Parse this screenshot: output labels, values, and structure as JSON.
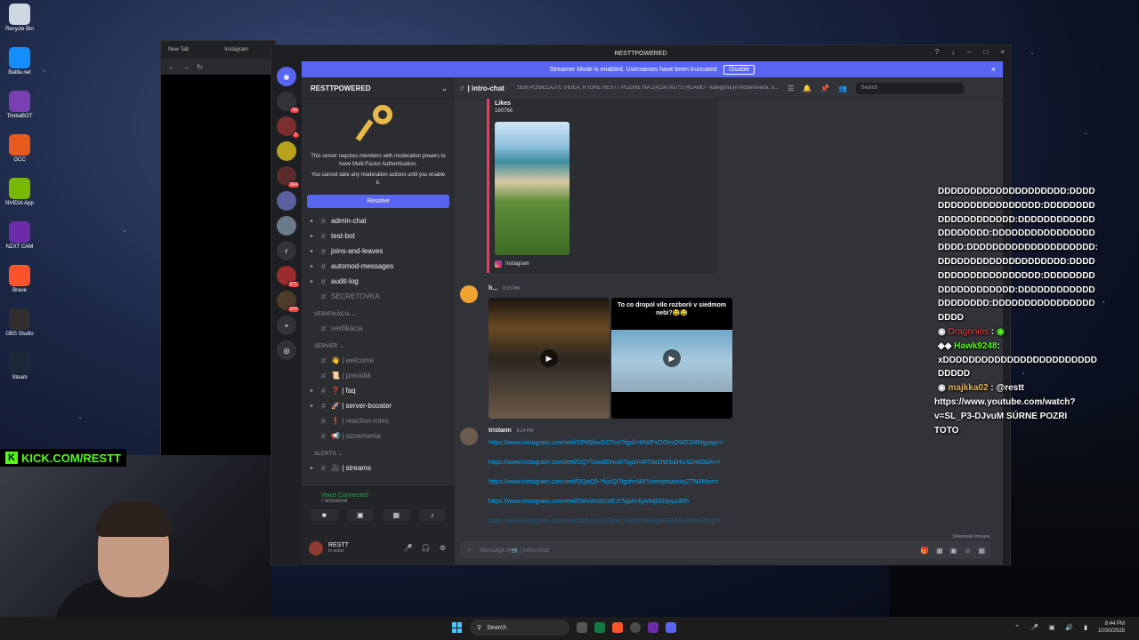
{
  "desktop_icons": [
    {
      "label": "Recycle Bin",
      "color": "#cfd8e0",
      "icon": "recycle-bin-icon"
    },
    {
      "label": "Battle.net",
      "color": "#148eff",
      "icon": "battlenet-icon"
    },
    {
      "label": "TimbaBOT",
      "color": "#7a3fb0",
      "icon": "bot-icon"
    },
    {
      "label": "GCC",
      "color": "#e85a1b",
      "icon": "gcc-icon"
    },
    {
      "label": "NVIDIA App",
      "color": "#76b900",
      "icon": "nvidia-icon"
    },
    {
      "label": "NZXT CAM",
      "color": "#6a2ca8",
      "icon": "nzxt-icon"
    },
    {
      "label": "Brave",
      "color": "#fb542b",
      "icon": "brave-icon"
    },
    {
      "label": "OBS Studio",
      "color": "#302e31",
      "icon": "obs-icon"
    },
    {
      "label": "Steam",
      "color": "#1b2838",
      "icon": "steam-icon"
    }
  ],
  "browser": {
    "tab1": "New Tab",
    "tab2": "Instagram"
  },
  "kick_banner": "KICK.COM/RESTT",
  "discord": {
    "window_title": "RESTTPOWERED",
    "banner": {
      "text": "Streamer Mode is enabled. Usernames have been truncated.",
      "button": "Disable"
    },
    "servers": [
      {
        "badge": "16",
        "color": "#313338"
      },
      {
        "badge": "1",
        "color": "#7a2e2e"
      },
      {
        "badge": "",
        "color": "#b8a21b"
      },
      {
        "badge": "164",
        "color": "#5b2b2b"
      },
      {
        "badge": "",
        "color": "#5a5fa0"
      },
      {
        "badge": "",
        "color": "#6b7a8a"
      },
      {
        "badge": "",
        "color": "#313338",
        "letter": "r"
      },
      {
        "badge": "271",
        "color": "#9b2c2c"
      },
      {
        "badge": "476",
        "color": "#4f3b2a"
      }
    ],
    "server_name": "RESTTPOWERED",
    "mfa": {
      "line1": "This server requires members with moderation powers to have Multi-Factor Authentication.",
      "line2": "You cannot take any moderation actions until you enable it.",
      "button": "Resolve"
    },
    "channels_top": [
      {
        "name": "admin-chat",
        "bold": true
      },
      {
        "name": "test-bot",
        "bold": true
      },
      {
        "name": "joins-and-leaves",
        "bold": true
      },
      {
        "name": "automod-messages",
        "bold": true
      },
      {
        "name": "audit-log",
        "bold": true
      },
      {
        "name": "SECRETOVKA",
        "bold": false
      }
    ],
    "cat_verification": "VERIFIKÁCIA",
    "channels_verif": [
      {
        "name": "verifikácia"
      }
    ],
    "cat_server": "SERVER",
    "channels_server": [
      {
        "name": "👋 | welcome",
        "bold": false
      },
      {
        "name": "📜 | pravidlá",
        "bold": false
      },
      {
        "name": "❓ | faq",
        "bold": true
      },
      {
        "name": "🚀 | server-booster",
        "bold": true
      },
      {
        "name": "❗ | reaction-roles",
        "bold": false
      },
      {
        "name": "📢 | oznamenia",
        "bold": false
      }
    ],
    "cat_alerts": "ALERTS",
    "channels_alerts": [
      {
        "name": "🎥 | streams",
        "bold": true
      }
    ],
    "voice": {
      "status": "Voice Connected",
      "channel": "/ restsecret"
    },
    "user": {
      "name": "RESTT",
      "status": "In voice"
    },
    "chat": {
      "channel": "| intro-chat",
      "topic": "SEM POSIELAJTE VIDEÁ, KTORÉ RESTT POZRIE NA ZAČIATKU STREAMU - kategória je moderovaná, a...",
      "search": "Search",
      "embed": {
        "likes_label": "Likes",
        "likes_value": "160766",
        "source": "Instagram"
      },
      "msg1": {
        "author": "h...",
        "time": "8:23 PM",
        "video2_caption": "To co dropol vilo rozborii v siedmom nebi?😂😂"
      },
      "msg2": {
        "author": "tristann",
        "time": "8:24 PM",
        "links": [
          "https://www.instagram.com/reel/DPd9bwZiOTm/?igsh=MWFsOGhvOW01MWgyag==",
          "https://www.instagram.com/reel/DQYVuw8DHo9/?igsh=MTdoOW1idHU4ZnM3dA==",
          "https://www.instagram.com/reel/DQaQ9-YkjcQ/?igsh=MXYxempmam4yZTN0Mw==",
          "https://www.instagram.com/reel/DMvWs9CstEJ/?igsh=bjAINjl3d3pya3Rh",
          "https://www.instagram.com/reel/DMLU1CcC8mr/?igsh=MWdqaGRkMmJwbnF5bg=="
        ]
      },
      "composer": "Message #📹 | intro-chat",
      "slowmode": "Slowmode Immune"
    }
  },
  "overlay_chat": {
    "spam1": [
      "DDDDDDDDDDDDDDDDDDDD:DDDD",
      "DDDDDDDDDDDDDDDD:DDDDDDDD",
      "DDDDDDDDDDDD:DDDDDDDDDDDD",
      "DDDDDDDD:DDDDDDDDDDDDDDDD",
      "DDDD:DDDDDDDDDDDDDDDDDDDD:",
      "DDDDDDDDDDDDDDDDDDDD:DDDD",
      "DDDDDDDDDDDDDDDD:DDDDDDDD",
      "DDDDDDDDDDDD:DDDDDDDDDDDD",
      "DDDDDDDD:DDDDDDDDDDDDDDDD",
      "DDDD"
    ],
    "user1": "Dragonios",
    "user1_msg": "",
    "user2": "Hawk9248",
    "user2_msg": [
      "xDDDDDDDDDDDDDDDDDDDDDDDD",
      "DDDDD"
    ],
    "user3": "majkka02",
    "user3_msg": "@restt",
    "user3_lines": [
      "https://www.youtube.com/watch?",
      "v=SL_P3-DJvuM SÚRNE POZRI",
      "TOTO"
    ]
  },
  "taskbar": {
    "search": "Search",
    "time": "8:44 PM",
    "date": "10/30/2025"
  }
}
